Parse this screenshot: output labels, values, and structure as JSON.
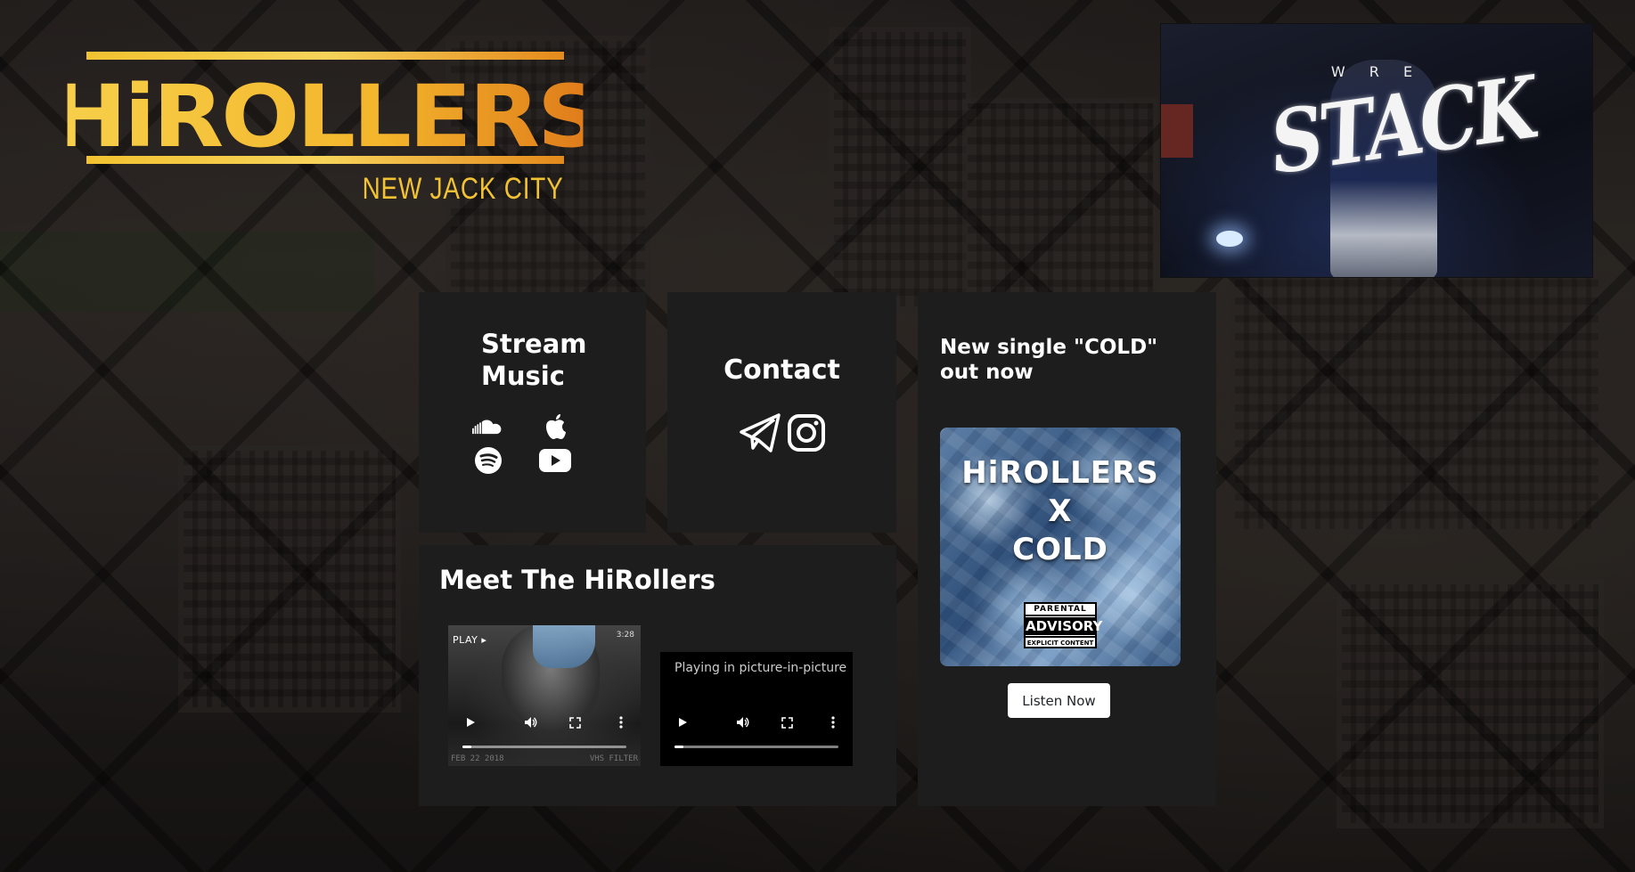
{
  "logo": {
    "name": "HiROLLERS",
    "subtitle": "NEW JACK CITY"
  },
  "banner": {
    "artist": "W R E",
    "title": "STACK"
  },
  "stream": {
    "heading_line1": "Stream",
    "heading_line2": "Music",
    "icons": [
      "soundcloud-icon",
      "apple-music-icon",
      "spotify-icon",
      "youtube-icon"
    ]
  },
  "contact": {
    "heading": "Contact",
    "icons": [
      "telegram-icon",
      "instagram-icon"
    ]
  },
  "single": {
    "heading": "New single \"COLD\" out now",
    "cover_line1": "HiROLLERS",
    "cover_line2": "X",
    "cover_line3": "COLD",
    "advisory_top": "PARENTAL",
    "advisory_mid": "ADVISORY",
    "advisory_bottom": "EXPLICIT CONTENT",
    "button": "Listen Now"
  },
  "meet": {
    "heading": "Meet The HiRollers",
    "video1": {
      "overlay": "PLAY ▸",
      "duration": "3:28",
      "stamp_left": "FEB 22 2018",
      "stamp_right": "VHS FILTER"
    },
    "video2": {
      "status": "Playing in picture-in-picture"
    }
  },
  "colors": {
    "gold": "#f2c232",
    "card": "#1d1d1d",
    "button_bg": "#ffffff"
  }
}
